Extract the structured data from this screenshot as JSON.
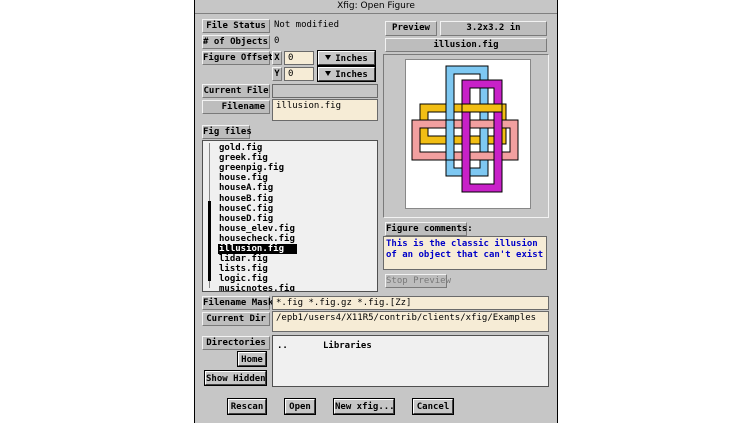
{
  "window": {
    "title": "Xfig: Open Figure"
  },
  "info": {
    "file_status_label": "File Status",
    "file_status_value": "Not modified",
    "num_objects_label": "# of Objects",
    "num_objects_value": "0",
    "figure_offset_label": "Figure Offset",
    "x_label": "X",
    "x_value": "0",
    "y_label": "Y",
    "y_value": "0",
    "units_label": "Inches",
    "current_file_label": "Current File",
    "current_file_value": "",
    "filename_label": "Filename",
    "filename_value": "illusion.fig"
  },
  "fig_files": {
    "label": "Fig files",
    "items": [
      "gold.fig",
      "greek.fig",
      "greenpig.fig",
      "house.fig",
      "houseA.fig",
      "houseB.fig",
      "houseC.fig",
      "houseD.fig",
      "house_elev.fig",
      "housecheck.fig",
      "illusion.fig",
      "lidar.fig",
      "lists.fig",
      "logic.fig",
      "musicnotes.fig"
    ],
    "selected": "illusion.fig"
  },
  "preview": {
    "button_label": "Preview",
    "size_value": "3.2x3.2 in",
    "filename": "illusion.fig",
    "comments_label": "Figure comments:",
    "comments_text": "This is the classic illusion of an object that can't exist",
    "stop_label": "Stop Preview",
    "colors": {
      "blue": "#7ec8f2",
      "magenta": "#c821c8",
      "pink": "#f2a0a0",
      "yellow": "#f2be14"
    }
  },
  "mask": {
    "label": "Filename Mask",
    "value": "*.fig *.fig.gz *.fig.[Zz]"
  },
  "current_dir": {
    "label": "Current Dir",
    "value": "/epb1/users4/X11R5/contrib/clients/xfig/Examples"
  },
  "directories": {
    "label": "Directories",
    "home_label": "Home",
    "show_hidden_label": "Show Hidden",
    "items": [
      "..",
      "Libraries"
    ]
  },
  "actions": {
    "rescan": "Rescan",
    "open": "Open",
    "new_xfig": "New xfig...",
    "cancel": "Cancel"
  }
}
